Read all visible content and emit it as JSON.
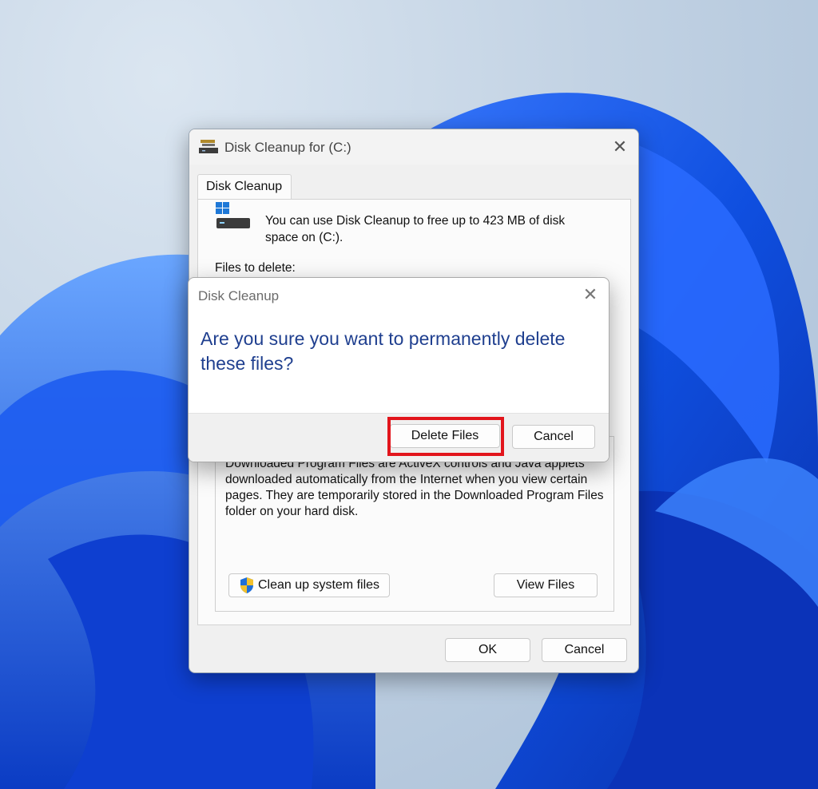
{
  "window": {
    "title": "Disk Cleanup for  (C:)",
    "close_glyph": "✕",
    "tab_label": "Disk Cleanup",
    "intro_text": "You can use Disk Cleanup to free up to 423 MB of disk space on  (C:).",
    "files_to_delete_label": "Files to delete:",
    "description_text": "Downloaded Program Files are ActiveX controls and Java applets downloaded automatically from the Internet when you view certain pages. They are temporarily stored in the Downloaded Program Files folder on your hard disk.",
    "cleanup_system_files_label": "Clean up system files",
    "view_files_label": "View Files",
    "ok_label": "OK",
    "cancel_label": "Cancel",
    "icons": [
      "disk-cleanup-app-icon",
      "drive-icon",
      "shield-icon",
      "close-icon"
    ]
  },
  "dialog": {
    "title": "Disk Cleanup",
    "close_glyph": "✕",
    "message": "Are you sure you want to permanently delete these files?",
    "delete_label": "Delete Files",
    "cancel_label": "Cancel",
    "message_color": "#1f3f8f",
    "highlight_color": "#e2151c"
  }
}
